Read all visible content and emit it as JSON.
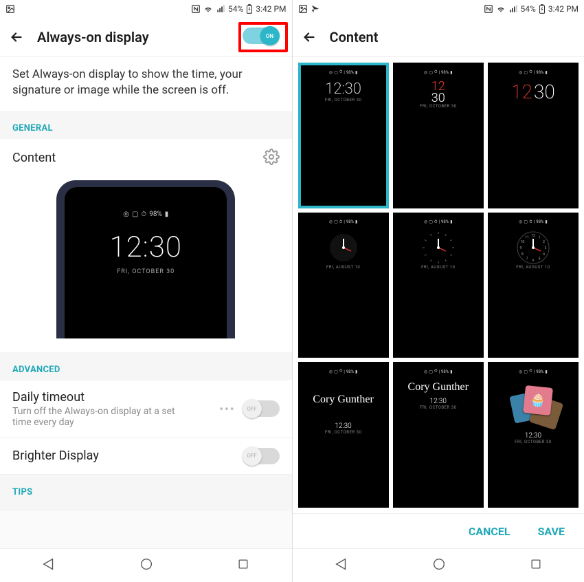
{
  "status": {
    "battery_pct": "54%",
    "time": "3:42 PM"
  },
  "left": {
    "title": "Always-on display",
    "toggle_on_label": "ON",
    "description": "Set Always-on display to show the time, your signature or image while the screen is off.",
    "section_general": "GENERAL",
    "content_label": "Content",
    "preview": {
      "icons_battery": "98%",
      "time": "12:30",
      "date": "FRI, OCTOBER 30"
    },
    "section_advanced": "ADVANCED",
    "daily_timeout": {
      "title": "Daily timeout",
      "sub": "Turn off the Always-on display at a set time every day",
      "toggle_label": "OFF"
    },
    "brighter_display": {
      "title": "Brighter Display",
      "toggle_label": "OFF"
    },
    "section_tips": "TIPS"
  },
  "right": {
    "title": "Content",
    "tiles": [
      {
        "icons_battery": "98%",
        "style": "digital-thin",
        "time": "12:30",
        "date": "FRI, OCTOBER 30",
        "selected": true
      },
      {
        "icons_battery": "98%",
        "style": "stack-red-white",
        "top": "12",
        "bottom": "30",
        "date": "FRI, OCTOBER 30"
      },
      {
        "icons_battery": "98%",
        "style": "side-red-white",
        "left": "12",
        "right_val": "30",
        "date": ""
      },
      {
        "icons_battery": "98%",
        "style": "analog-minimal",
        "date": "FRI, AUGUST 10"
      },
      {
        "icons_battery": "98%",
        "style": "analog-ticks",
        "date": "FRI, AUGUST 10"
      },
      {
        "icons_battery": "98%",
        "style": "analog-numbers",
        "date": "FRI, AUGUST 10"
      },
      {
        "icons_battery": "98%",
        "style": "signature-bottom",
        "sig": "Cory Gunther",
        "time": "12:30",
        "date": "FRI, OCTOBER 30"
      },
      {
        "icons_battery": "98%",
        "style": "signature-top",
        "sig": "Cory Gunther",
        "time": "12:30",
        "date": "FRI, OCTOBER 30"
      },
      {
        "icons_battery": "98%",
        "style": "photo",
        "time": "12:30",
        "date": "FRI, OCTOBER 30"
      }
    ],
    "cancel": "CANCEL",
    "save": "SAVE"
  }
}
